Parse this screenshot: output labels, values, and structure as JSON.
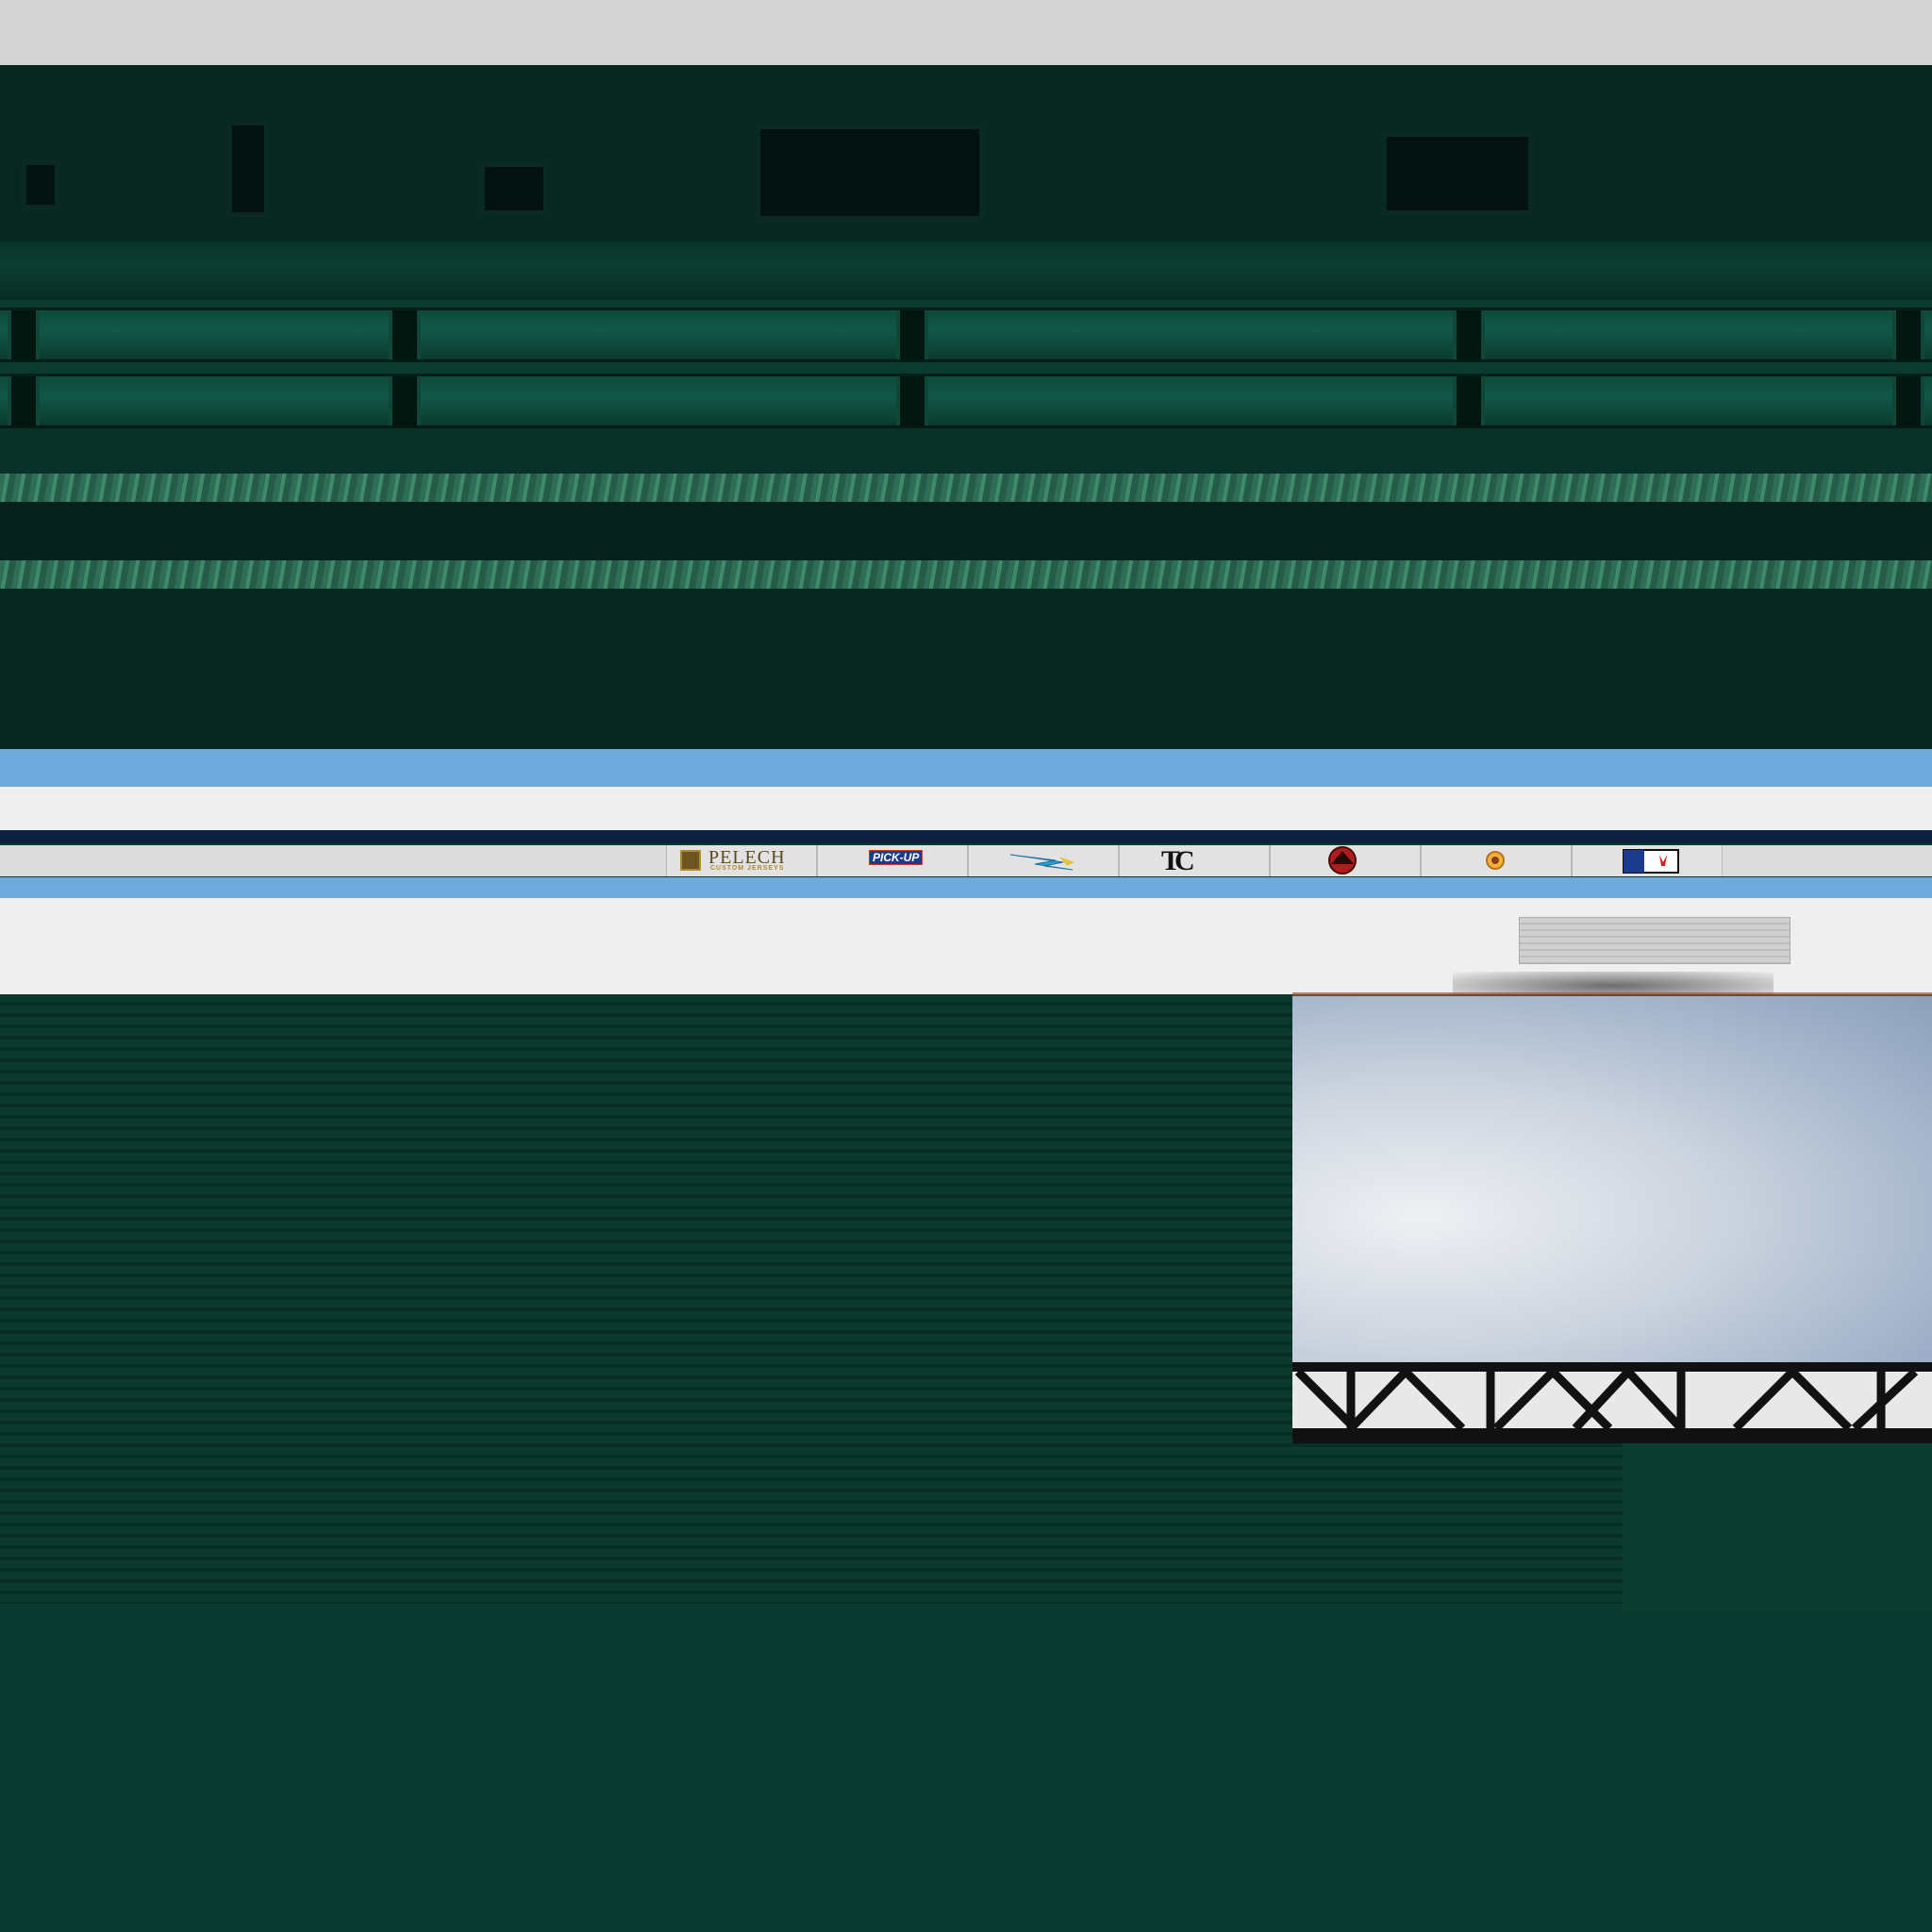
{
  "colors": {
    "wall_dark": "#072820",
    "wall_green": "#0b3a2e",
    "ad_blue": "#6eaadc",
    "ad_navy": "#0f1f3f",
    "board_white": "#efefef",
    "sky": "#9fb0c8"
  },
  "sponsors": [
    {
      "name": "PELECH",
      "subtitle": "CUSTOM JERSEYS",
      "icon": "pelech-logo"
    },
    {
      "name": "PICK-UP",
      "icon": "pickup-logo"
    },
    {
      "name": "",
      "icon": "lightning-bird-logo"
    },
    {
      "name": "TC",
      "icon": "tc-logo"
    },
    {
      "name": "",
      "icon": "dragon-logo"
    },
    {
      "name": "",
      "icon": "sun-logo"
    },
    {
      "name": "",
      "icon": "flag-logo"
    }
  ]
}
